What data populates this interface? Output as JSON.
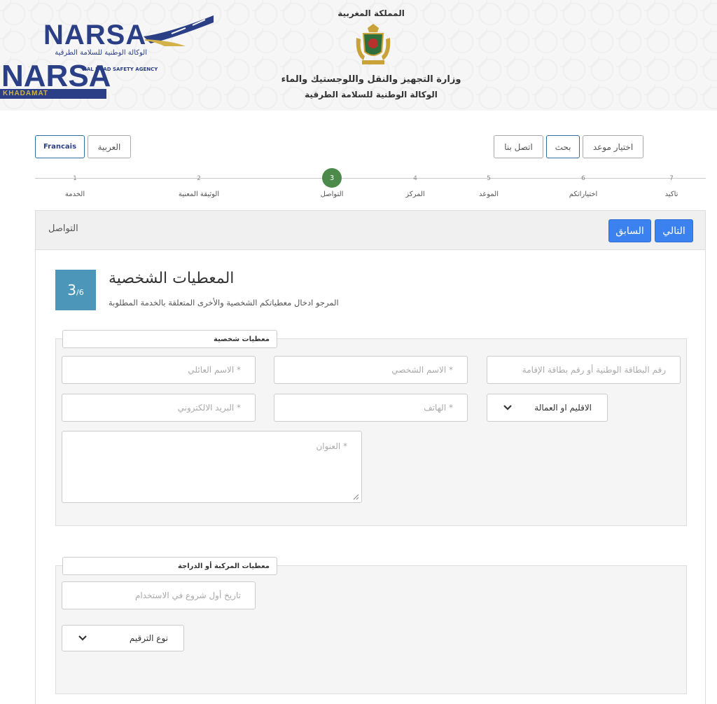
{
  "header": {
    "logo_primary": "NARSA",
    "logo_primary_sub": "الوكالة الوطنية للسلامة الطرقية",
    "logo_secondary": "NARSA",
    "logo_secondary_agency": "NAL ROAD SAFETY AGENCY",
    "logo_secondary_bar": "KHADAMAT",
    "kingdom": "المملكة المغربية",
    "ministry_line1": "وزارة التجهيز والنقل واللوجستيك والماء",
    "ministry_line2": "الوكالة الوطنية للسلامة الطرقية",
    "brand_color": "#2b3f86"
  },
  "nav": {
    "lang_fr": "Francais",
    "lang_ar": "العربية",
    "contact": "اتصل بنا",
    "search": "بحث",
    "appointment": "اختيار موعد"
  },
  "stepper": {
    "steps": [
      {
        "num": "1",
        "label": "الخدمة"
      },
      {
        "num": "2",
        "label": "الوثيقة المعنية"
      },
      {
        "num": "3",
        "label": "التواصل"
      },
      {
        "num": "4",
        "label": "المركز"
      },
      {
        "num": "5",
        "label": "الموعد"
      },
      {
        "num": "6",
        "label": "اختياراتكم"
      },
      {
        "num": "7",
        "label": "تاكيد"
      }
    ],
    "active_step": 3,
    "active_color": "#4b8a4b"
  },
  "panel": {
    "title": "التواصل",
    "next_label": "التالي",
    "prev_label": "السابق",
    "primary_color": "#3b82f0",
    "badge_num": "3",
    "badge_total": "/6",
    "heading": "المعطيات الشخصية",
    "description": "المرجو ادخال معطياتكم الشخصية والأخرى المتعلقة بالخدمة المطلوبة"
  },
  "personal": {
    "legend": "معطيات شخصية",
    "id_number": "رقم البطاقة الوطنية أو رقم بطاقة الإقامة",
    "first_name": "* الاسم الشخصي",
    "last_name": "* الاسم العائلي",
    "province": "الاقليم او العمالة",
    "phone": "* الهاتف",
    "email": "* البريد الالكتروني",
    "address": "* العنوان"
  },
  "vehicle": {
    "legend": "معطيات المركبة أو الدراجة",
    "first_use_date": "تاريخ أول شروع في الاستخدام",
    "plate_type": "نوع الترقيم"
  }
}
